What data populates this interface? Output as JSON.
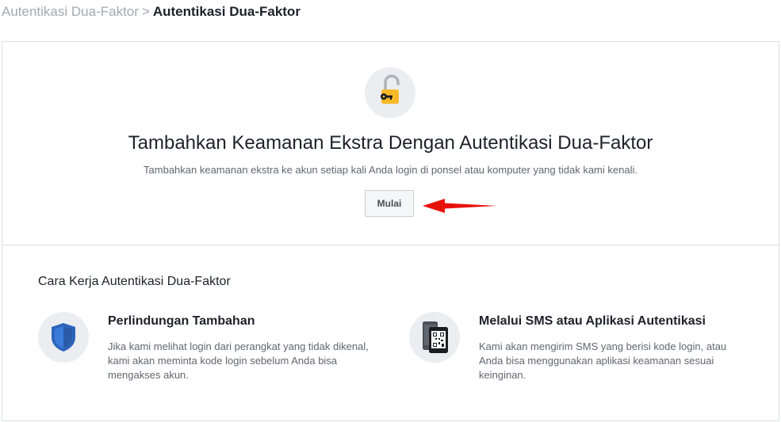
{
  "breadcrumb": {
    "parent": "Autentikasi Dua-Faktor",
    "separator": ">",
    "current": "Autentikasi Dua-Faktor"
  },
  "hero": {
    "icon": "unlocked-padlock-key-icon",
    "title": "Tambahkan Keamanan Ekstra Dengan Autentikasi Dua-Faktor",
    "subtitle": "Tambahkan keamanan ekstra ke akun setiap kali Anda login di ponsel atau komputer yang tidak kami kenali.",
    "start_label": "Mulai"
  },
  "annotation": {
    "icon": "red-arrow-pointer",
    "color": "#e8120c"
  },
  "how_it_works": {
    "title": "Cara Kerja Autentikasi Dua-Faktor",
    "features": [
      {
        "icon": "shield-icon",
        "title": "Perlindungan Tambahan",
        "description": "Jika kami melihat login dari perangkat yang tidak dikenal, kami akan meminta kode login sebelum Anda bisa mengakses akun."
      },
      {
        "icon": "phone-qr-code-icon",
        "title": "Melalui SMS atau Aplikasi Autentikasi",
        "description": "Kami akan mengirim SMS yang berisi kode login, atau Anda bisa menggunakan aplikasi keamanan sesuai keinginan."
      }
    ]
  },
  "colors": {
    "border": "#dddfe2",
    "icon_bg": "#ebedf0",
    "lock_yellow": "#f7b928",
    "shield_blue": "#2d64bc",
    "muted_text": "#606770"
  }
}
